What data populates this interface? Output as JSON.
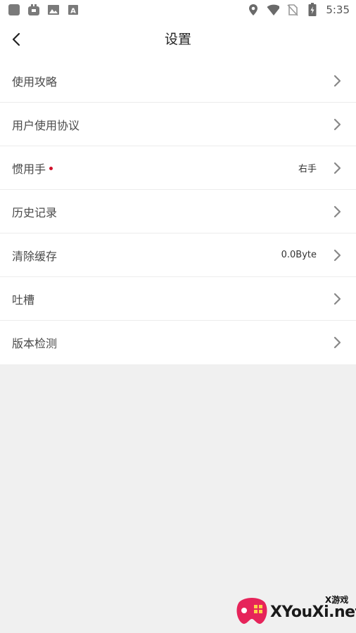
{
  "status_bar": {
    "time": "5:35",
    "left_icons": [
      "app-square-icon",
      "app-store-icon",
      "image-icon",
      "font-a-icon"
    ],
    "right_icons": [
      "location-icon",
      "wifi-icon",
      "no-sim-icon",
      "battery-charging-icon"
    ]
  },
  "header": {
    "title": "设置",
    "back_icon": "back-arrow-icon"
  },
  "settings": [
    {
      "key": "guide",
      "label": "使用攻略",
      "value": "",
      "dot": false
    },
    {
      "key": "agreement",
      "label": "用户使用协议",
      "value": "",
      "dot": false
    },
    {
      "key": "handedness",
      "label": "惯用手",
      "value": "右手",
      "dot": true
    },
    {
      "key": "history",
      "label": "历史记录",
      "value": "",
      "dot": false
    },
    {
      "key": "cache",
      "label": "清除缓存",
      "value": "0.0Byte",
      "dot": false
    },
    {
      "key": "feedback",
      "label": "吐槽",
      "value": "",
      "dot": false
    },
    {
      "key": "version",
      "label": "版本检测",
      "value": "",
      "dot": false
    }
  ],
  "watermark": {
    "small": "X游戏",
    "big": "XYouXi.net"
  },
  "colors": {
    "background": "#f0f0f0",
    "list_bg": "#ffffff",
    "dot": "#d0102a",
    "chevron": "#888888"
  }
}
